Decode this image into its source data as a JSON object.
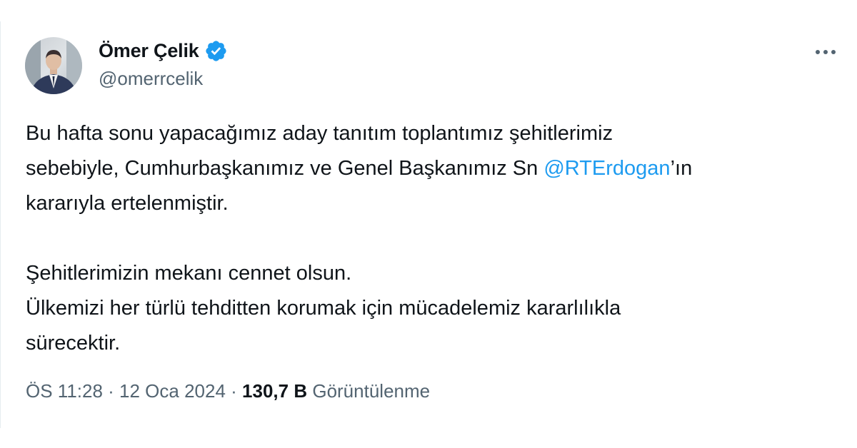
{
  "author": {
    "display_name": "Ömer Çelik",
    "handle": "@omerrcelik",
    "verified_icon": "verified-badge-icon",
    "avatar": "profile-photo"
  },
  "menu": {
    "icon": "more-options-icon"
  },
  "tweet": {
    "p1_before": "Bu hafta sonu yapacağımız aday tanıtım toplantımız şehitlerimiz\nsebebiyle, Cumhurbaşkanımız ve Genel Başkanımız Sn ",
    "mention": "@RTErdogan",
    "p1_after": "’ın\nkararıyla ertelenmiştir.",
    "p2": "Şehitlerimizin mekanı cennet olsun.\nÜlkemizi her türlü tehditten korumak için mücadelemiz kararlılıkla\nsürecektir."
  },
  "meta": {
    "timestamp": "ÖS 11:28 · 12 Oca 2024",
    "separator": " · ",
    "views_count": "130,7 B",
    "views_label": "Görüntülenme"
  },
  "colors": {
    "text": "#0f1419",
    "secondary": "#536471",
    "link": "#1d9bf0",
    "badge": "#1d9bf0"
  }
}
